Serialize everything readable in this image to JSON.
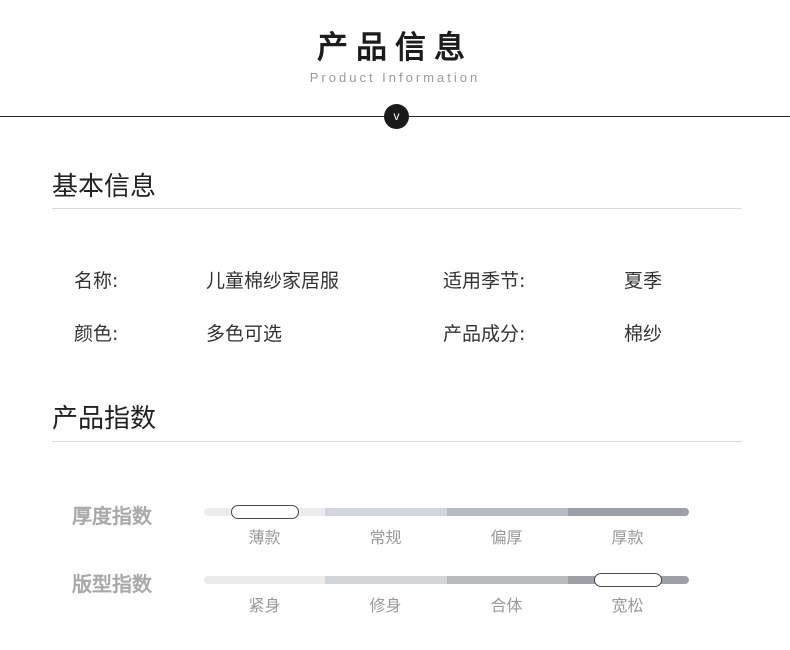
{
  "header": {
    "title": "产品信息",
    "subtitle": "Product Information",
    "badge": "v"
  },
  "basic_info": {
    "title": "基本信息",
    "rows": [
      [
        {
          "label": "名称:",
          "value": "儿童棉纱家居服"
        },
        {
          "label": "适用季节:",
          "value": "夏季"
        }
      ],
      [
        {
          "label": "颜色:",
          "value": "多色可选"
        },
        {
          "label": "产品成分:",
          "value": "棉纱"
        }
      ]
    ]
  },
  "product_index": {
    "title": "产品指数",
    "indices": [
      {
        "label": "厚度指数",
        "options": [
          "薄款",
          "常规",
          "偏厚",
          "厚款"
        ],
        "selected_index": 0
      },
      {
        "label": "版型指数",
        "options": [
          "紧身",
          "修身",
          "合体",
          "宽松"
        ],
        "selected_index": 3
      }
    ]
  }
}
